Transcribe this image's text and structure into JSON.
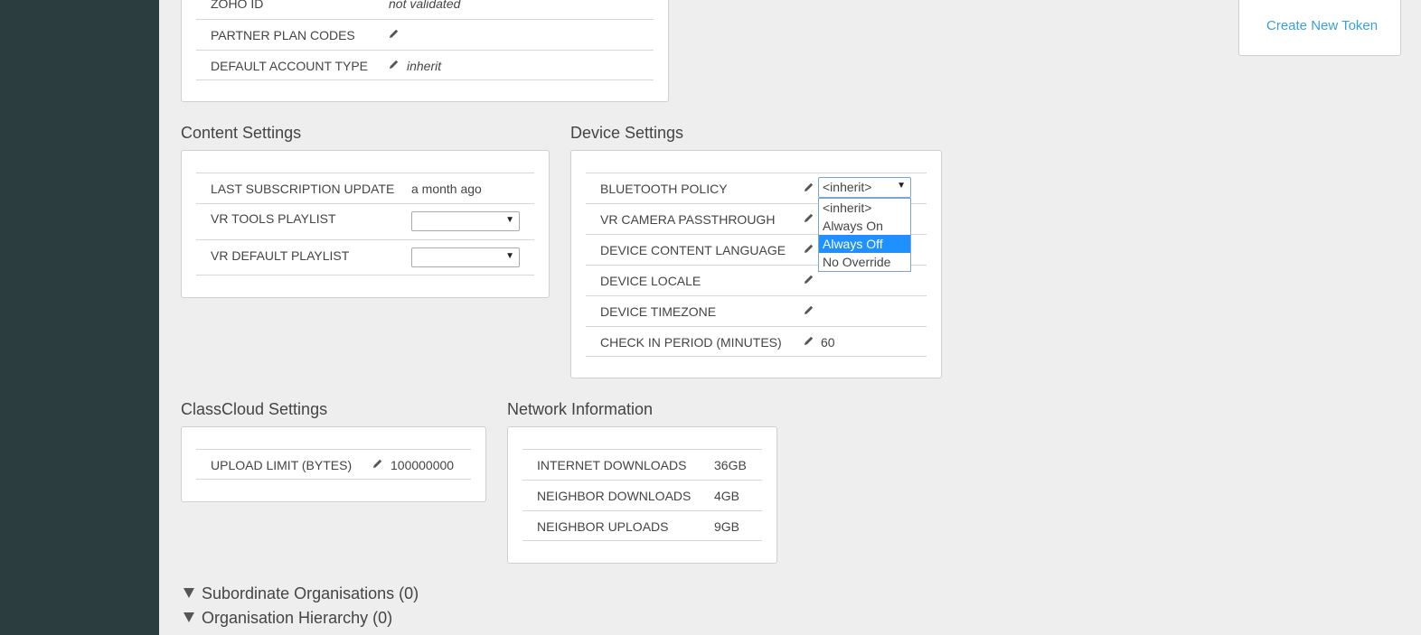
{
  "account": {
    "rows": [
      {
        "label": "ZOHO ID",
        "value": "not validated"
      },
      {
        "label": "PARTNER PLAN CODES",
        "value": ""
      },
      {
        "label": "DEFAULT ACCOUNT TYPE",
        "value": "inherit"
      }
    ]
  },
  "token": {
    "create_label": "Create New Token"
  },
  "content_settings": {
    "title": "Content Settings",
    "last_update_label": "LAST SUBSCRIPTION UPDATE",
    "last_update_value": "a month ago",
    "vr_tools_label": "VR TOOLS PLAYLIST",
    "vr_tools_value": "",
    "vr_default_label": "VR DEFAULT PLAYLIST",
    "vr_default_value": ""
  },
  "device_settings": {
    "title": "Device Settings",
    "bluetooth_label": "BLUETOOTH POLICY",
    "bluetooth_value": "<inherit>",
    "bluetooth_options": [
      "<inherit>",
      "Always On",
      "Always Off",
      "No Override"
    ],
    "bluetooth_highlighted": "Always Off",
    "passthrough_label": "VR CAMERA PASSTHROUGH",
    "language_label": "DEVICE CONTENT LANGUAGE",
    "locale_label": "DEVICE LOCALE",
    "timezone_label": "DEVICE TIMEZONE",
    "checkin_label": "CHECK IN PERIOD (MINUTES)",
    "checkin_value": "60"
  },
  "classcloud": {
    "title": "ClassCloud Settings",
    "upload_label": "UPLOAD LIMIT (BYTES)",
    "upload_value": "100000000"
  },
  "network": {
    "title": "Network Information",
    "internet_label": "INTERNET DOWNLOADS",
    "internet_value": "36GB",
    "neighbor_dl_label": "NEIGHBOR DOWNLOADS",
    "neighbor_dl_value": "4GB",
    "neighbor_ul_label": "NEIGHBOR UPLOADS",
    "neighbor_ul_value": "9GB"
  },
  "sections": {
    "subordinate": "Subordinate Organisations (0)",
    "hierarchy": "Organisation Hierarchy (0)"
  },
  "icons": {
    "edit": "pencil-icon",
    "expand": "triangle-down-icon"
  }
}
